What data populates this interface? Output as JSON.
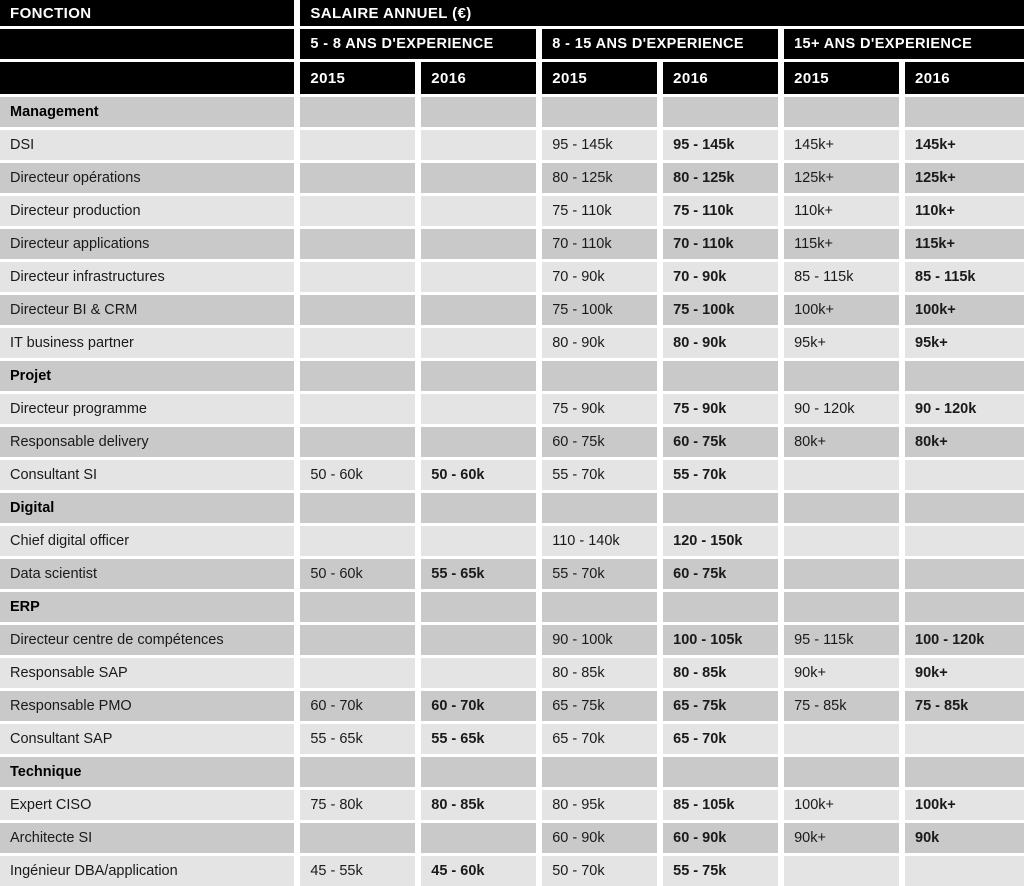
{
  "header": {
    "fonction_label": "FONCTION",
    "salaire_label": "SALAIRE ANNUEL (€)",
    "experience_groups": [
      "5 - 8 ANS D'EXPERIENCE",
      "8 - 15 ANS D'EXPERIENCE",
      "15+ ANS D'EXPERIENCE"
    ],
    "years": [
      "2015",
      "2016",
      "2015",
      "2016",
      "2015",
      "2016"
    ]
  },
  "colors": {
    "header_bg": "#000000",
    "header_text": "#ffffff",
    "row_dark": "#c9c9c9",
    "row_light": "#e4e4e4",
    "grid_gap": "#ffffff",
    "body_text": "#1a1a1a"
  },
  "table": {
    "columns": [
      "FONCTION",
      "5-8 ans 2015",
      "5-8 ans 2016",
      "8-15 ans 2015",
      "8-15 ans 2016",
      "15+ ans 2015",
      "15+ ans 2016"
    ],
    "rows": [
      {
        "type": "section",
        "fonction": "Management",
        "values": [
          "",
          "",
          "",
          "",
          "",
          ""
        ]
      },
      {
        "type": "data",
        "fonction": "DSI",
        "values": [
          "",
          "",
          "95 - 145k",
          "95 - 145k",
          "145k+",
          "145k+"
        ]
      },
      {
        "type": "data",
        "fonction": "Directeur opérations",
        "values": [
          "",
          "",
          "80 - 125k",
          "80 - 125k",
          "125k+",
          "125k+"
        ]
      },
      {
        "type": "data",
        "fonction": "Directeur production",
        "values": [
          "",
          "",
          "75 - 110k",
          "75 - 110k",
          "110k+",
          "110k+"
        ]
      },
      {
        "type": "data",
        "fonction": "Directeur applications",
        "values": [
          "",
          "",
          "70 - 110k",
          "70 - 110k",
          "115k+",
          "115k+"
        ]
      },
      {
        "type": "data",
        "fonction": "Directeur infrastructures",
        "values": [
          "",
          "",
          "70 - 90k",
          "70 - 90k",
          "85 - 115k",
          "85 - 115k"
        ]
      },
      {
        "type": "data",
        "fonction": "Directeur BI & CRM",
        "values": [
          "",
          "",
          "75 - 100k",
          "75 - 100k",
          "100k+",
          "100k+"
        ]
      },
      {
        "type": "data",
        "fonction": "IT business partner",
        "values": [
          "",
          "",
          "80 - 90k",
          "80 - 90k",
          "95k+",
          "95k+"
        ]
      },
      {
        "type": "section",
        "fonction": "Projet",
        "values": [
          "",
          "",
          "",
          "",
          "",
          ""
        ]
      },
      {
        "type": "data",
        "fonction": "Directeur programme",
        "values": [
          "",
          "",
          "75 - 90k",
          "75 - 90k",
          "90 - 120k",
          "90 - 120k"
        ]
      },
      {
        "type": "data",
        "fonction": "Responsable delivery",
        "values": [
          "",
          "",
          "60 - 75k",
          "60 - 75k",
          "80k+",
          "80k+"
        ]
      },
      {
        "type": "data",
        "fonction": "Consultant SI",
        "values": [
          "50 - 60k",
          "50 - 60k",
          "55 - 70k",
          "55 - 70k",
          "",
          ""
        ]
      },
      {
        "type": "section",
        "fonction": "Digital",
        "values": [
          "",
          "",
          "",
          "",
          "",
          ""
        ]
      },
      {
        "type": "data",
        "fonction": "Chief digital officer",
        "values": [
          "",
          "",
          "110 - 140k",
          "120 - 150k",
          "",
          ""
        ]
      },
      {
        "type": "data",
        "fonction": "Data scientist",
        "values": [
          "50 - 60k",
          "55 - 65k",
          "55 - 70k",
          "60 - 75k",
          "",
          ""
        ]
      },
      {
        "type": "section",
        "fonction": "ERP",
        "values": [
          "",
          "",
          "",
          "",
          "",
          ""
        ]
      },
      {
        "type": "data",
        "fonction": "Directeur centre de compétences",
        "values": [
          "",
          "",
          "90 - 100k",
          "100 - 105k",
          "95 - 115k",
          "100 - 120k"
        ]
      },
      {
        "type": "data",
        "fonction": "Responsable SAP",
        "values": [
          "",
          "",
          "80 - 85k",
          "80 - 85k",
          "90k+",
          "90k+"
        ]
      },
      {
        "type": "data",
        "fonction": "Responsable PMO",
        "values": [
          "60 - 70k",
          "60 - 70k",
          "65 - 75k",
          "65 - 75k",
          "75 - 85k",
          "75 - 85k"
        ]
      },
      {
        "type": "data",
        "fonction": "Consultant SAP",
        "values": [
          "55 - 65k",
          "55 - 65k",
          "65 - 70k",
          "65 - 70k",
          "",
          ""
        ]
      },
      {
        "type": "section",
        "fonction": "Technique",
        "values": [
          "",
          "",
          "",
          "",
          "",
          ""
        ]
      },
      {
        "type": "data",
        "fonction": "Expert CISO",
        "values": [
          "75 - 80k",
          "80 - 85k",
          "80 - 95k",
          "85 - 105k",
          "100k+",
          "100k+"
        ]
      },
      {
        "type": "data",
        "fonction": "Architecte SI",
        "values": [
          "",
          "",
          "60 - 90k",
          "60 - 90k",
          "90k+",
          "90k"
        ]
      },
      {
        "type": "data",
        "fonction": "Ingénieur DBA/application",
        "values": [
          "45 - 55k",
          "45 - 60k",
          "50 - 70k",
          "55 - 75k",
          "",
          ""
        ]
      }
    ]
  }
}
